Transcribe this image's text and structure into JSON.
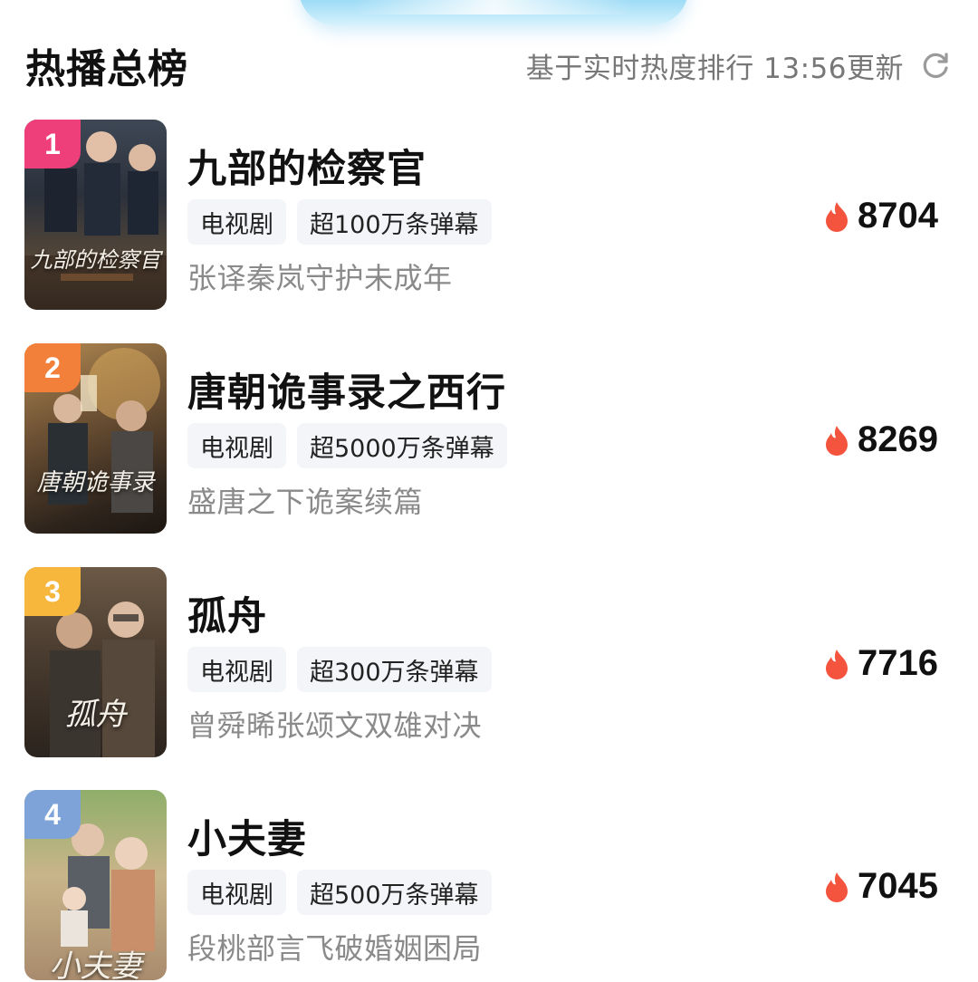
{
  "header": {
    "title": "热播总榜",
    "update_text": "基于实时热度排行 13:56更新",
    "refresh_icon": "refresh-icon"
  },
  "colors": {
    "rank1": "#ee3f7a",
    "rank2": "#f3803a",
    "rank3": "#f6b73c",
    "rank4": "#7da3d9",
    "flame": "#f4533d",
    "desc": "#8a8a8a"
  },
  "items": [
    {
      "rank": "1",
      "name": "九部的检察官",
      "tags": [
        "电视剧",
        "超100万条弹幕"
      ],
      "desc": "张译秦岚守护未成年",
      "score": "8704",
      "poster_text": "九部的检察官"
    },
    {
      "rank": "2",
      "name": "唐朝诡事录之西行",
      "tags": [
        "电视剧",
        "超5000万条弹幕"
      ],
      "desc": "盛唐之下诡案续篇",
      "score": "8269",
      "poster_text": "唐朝诡事录"
    },
    {
      "rank": "3",
      "name": "孤舟",
      "tags": [
        "电视剧",
        "超300万条弹幕"
      ],
      "desc": "曾舜晞张颂文双雄对决",
      "score": "7716",
      "poster_text": "孤舟"
    },
    {
      "rank": "4",
      "name": "小夫妻",
      "tags": [
        "电视剧",
        "超500万条弹幕"
      ],
      "desc": "段桃部言飞破婚姻困局",
      "score": "7045",
      "poster_text": "小夫妻"
    }
  ]
}
